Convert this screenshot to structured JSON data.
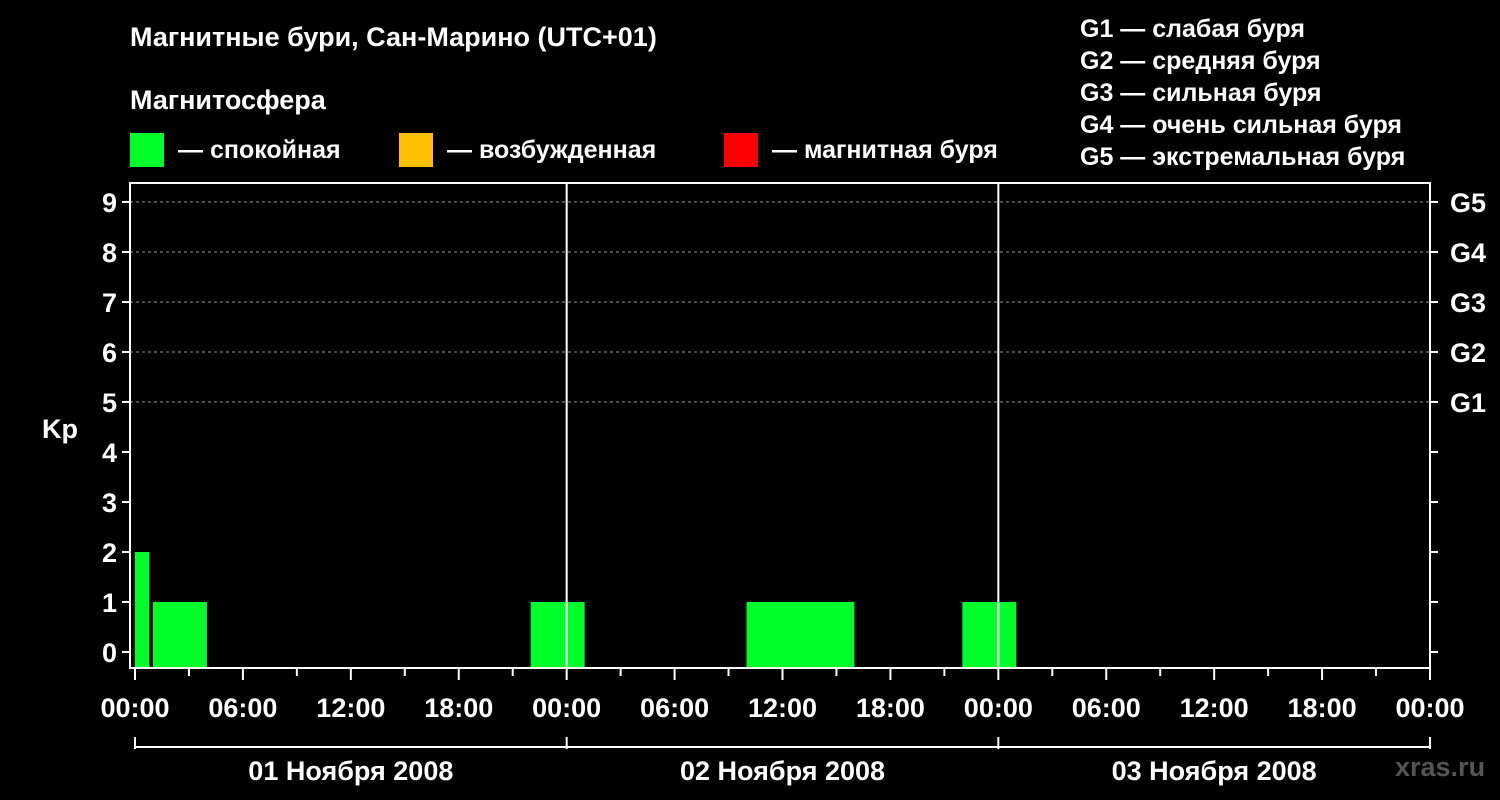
{
  "title": "Магнитные бури, Сан-Марино (UTC+01)",
  "subtitle": "Магнитосфера",
  "legend": [
    {
      "label": "— спокойная",
      "color": "#00ff2a"
    },
    {
      "label": "— возбужденная",
      "color": "#ffc000"
    },
    {
      "label": "— магнитная буря",
      "color": "#ff0000"
    }
  ],
  "g_levels": [
    "G1 — слабая буря",
    "G2 — средняя буря",
    "G3 — сильная буря",
    "G4 — очень сильная буря",
    "G5 — экстремальная буря"
  ],
  "watermark": "xras.ru",
  "chart_data": {
    "type": "bar",
    "ylabel": "Kp",
    "ylim": [
      0,
      9
    ],
    "yticks": [
      "0",
      "1",
      "2",
      "3",
      "4",
      "5",
      "6",
      "7",
      "8",
      "9"
    ],
    "right_labels": [
      {
        "kp": 5,
        "label": "G1"
      },
      {
        "kp": 6,
        "label": "G2"
      },
      {
        "kp": 7,
        "label": "G3"
      },
      {
        "kp": 8,
        "label": "G4"
      },
      {
        "kp": 9,
        "label": "G5"
      }
    ],
    "grid": true,
    "xlim_hours": [
      0,
      72
    ],
    "xticks": [
      "00:00",
      "06:00",
      "12:00",
      "18:00",
      "00:00",
      "06:00",
      "12:00",
      "18:00",
      "00:00",
      "06:00",
      "12:00",
      "18:00",
      "00:00"
    ],
    "days": [
      "01 Ноября 2008",
      "02 Ноября 2008",
      "03 Ноября 2008"
    ],
    "bars": [
      {
        "start": 0,
        "end": 0.8,
        "kp": 2,
        "color": "#00ff2a"
      },
      {
        "start": 1,
        "end": 4,
        "kp": 1,
        "color": "#00ff2a"
      },
      {
        "start": 22,
        "end": 25,
        "kp": 1,
        "color": "#00ff2a"
      },
      {
        "start": 34,
        "end": 37,
        "kp": 1,
        "color": "#00ff2a"
      },
      {
        "start": 37,
        "end": 40,
        "kp": 1,
        "color": "#00ff2a"
      },
      {
        "start": 46,
        "end": 49,
        "kp": 1,
        "color": "#00ff2a"
      }
    ]
  }
}
